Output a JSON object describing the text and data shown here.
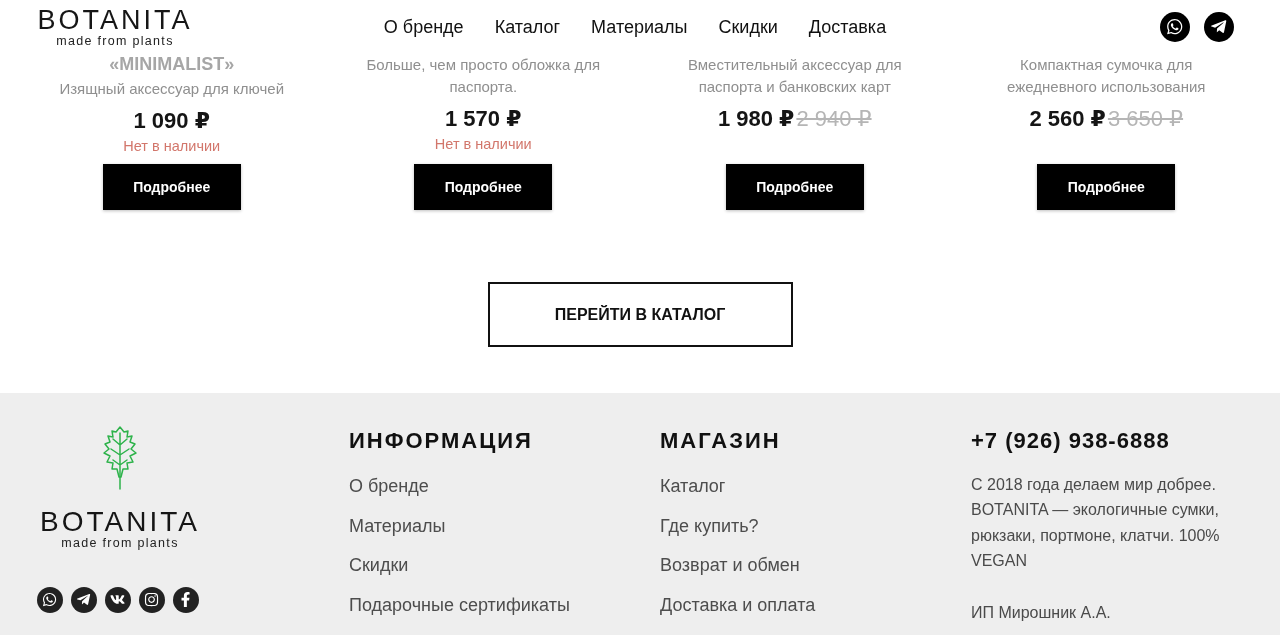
{
  "header": {
    "logo": {
      "name": "BOTANITA",
      "tagline": "made from plants"
    },
    "nav": [
      "О бренде",
      "Каталог",
      "Материалы",
      "Скидки",
      "Доставка"
    ]
  },
  "products": [
    {
      "title": "«MINIMALIST»",
      "description": "Изящный аксессуар для ключей",
      "price": "1 090 ₽",
      "status": "Нет в наличии",
      "button": "Подробнее"
    },
    {
      "description": "Больше, чем просто обложка для паспорта.",
      "price": "1 570 ₽",
      "status": "Нет в наличии",
      "button": "Подробнее"
    },
    {
      "description": "Вместительный аксессуар для паспорта и банковских карт",
      "price": "1 980 ₽",
      "old_price": "2 940 ₽",
      "button": "Подробнее"
    },
    {
      "description": "Компактная сумочка для ежедневного использования",
      "price": "2 560 ₽",
      "old_price": "3 650 ₽",
      "button": "Подробнее"
    }
  ],
  "catalog_button": "ПЕРЕЙТИ В КАТАЛОГ",
  "footer": {
    "logo": {
      "name": "BOTANITA",
      "tagline": "made from plants"
    },
    "columns": [
      {
        "title": "ИНФОРМАЦИЯ",
        "links": [
          "О бренде",
          "Материалы",
          "Скидки",
          "Подарочные сертификаты"
        ]
      },
      {
        "title": "МАГАЗИН",
        "links": [
          "Каталог",
          "Где купить?",
          "Возврат и обмен",
          "Доставка и оплата"
        ]
      }
    ],
    "contacts": {
      "phone": "+7 (926) 938-6888",
      "about": "С 2018 года делаем мир добрее. BOTANITA — экологичные сумки, рюкзаки, портмоне, клатчи. 100% VEGAN",
      "company": "ИП Мирошник А.А."
    }
  }
}
